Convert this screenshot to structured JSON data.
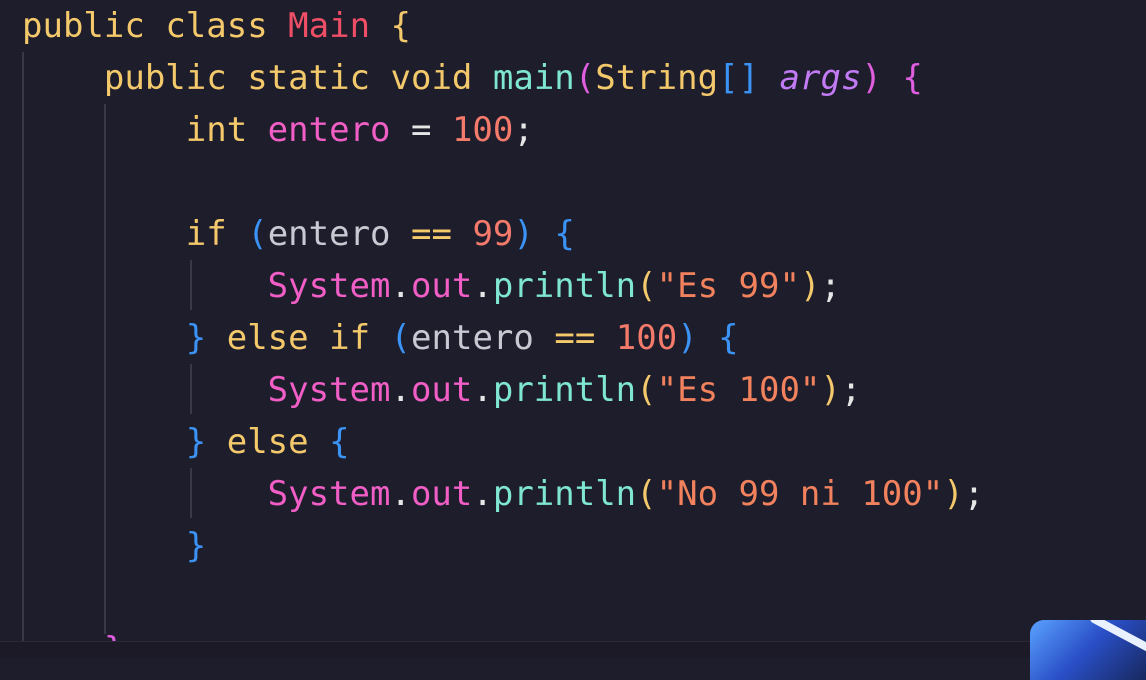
{
  "editor": {
    "lines": [
      {
        "tokens": [
          {
            "t": "public",
            "c": "kw"
          },
          {
            "t": " ",
            "c": "plain"
          },
          {
            "t": "class",
            "c": "kw"
          },
          {
            "t": " ",
            "c": "plain"
          },
          {
            "t": "Main",
            "c": "cls"
          },
          {
            "t": " ",
            "c": "plain"
          },
          {
            "t": "{",
            "c": "p1"
          }
        ]
      },
      {
        "tokens": [
          {
            "t": "    ",
            "c": "plain"
          },
          {
            "t": "public",
            "c": "kw"
          },
          {
            "t": " ",
            "c": "plain"
          },
          {
            "t": "static",
            "c": "kw"
          },
          {
            "t": " ",
            "c": "plain"
          },
          {
            "t": "void",
            "c": "kw"
          },
          {
            "t": " ",
            "c": "plain"
          },
          {
            "t": "main",
            "c": "fn"
          },
          {
            "t": "(",
            "c": "p2"
          },
          {
            "t": "String",
            "c": "kw"
          },
          {
            "t": "[]",
            "c": "p3"
          },
          {
            "t": " ",
            "c": "plain"
          },
          {
            "t": "args",
            "c": "param"
          },
          {
            "t": ")",
            "c": "p2"
          },
          {
            "t": " ",
            "c": "plain"
          },
          {
            "t": "{",
            "c": "p2"
          }
        ]
      },
      {
        "tokens": [
          {
            "t": "        ",
            "c": "plain"
          },
          {
            "t": "int",
            "c": "kw"
          },
          {
            "t": " ",
            "c": "plain"
          },
          {
            "t": "entero",
            "c": "var"
          },
          {
            "t": " ",
            "c": "plain"
          },
          {
            "t": "=",
            "c": "plain"
          },
          {
            "t": " ",
            "c": "plain"
          },
          {
            "t": "100",
            "c": "num"
          },
          {
            "t": ";",
            "c": "plain"
          }
        ]
      },
      {
        "tokens": []
      },
      {
        "tokens": [
          {
            "t": "        ",
            "c": "plain"
          },
          {
            "t": "if",
            "c": "kw"
          },
          {
            "t": " ",
            "c": "plain"
          },
          {
            "t": "(",
            "c": "p3"
          },
          {
            "t": "entero",
            "c": "dim"
          },
          {
            "t": " ",
            "c": "plain"
          },
          {
            "t": "==",
            "c": "kw"
          },
          {
            "t": " ",
            "c": "plain"
          },
          {
            "t": "99",
            "c": "num"
          },
          {
            "t": ")",
            "c": "p3"
          },
          {
            "t": " ",
            "c": "plain"
          },
          {
            "t": "{",
            "c": "p3"
          }
        ]
      },
      {
        "tokens": [
          {
            "t": "            ",
            "c": "plain"
          },
          {
            "t": "System",
            "c": "var"
          },
          {
            "t": ".",
            "c": "plain"
          },
          {
            "t": "out",
            "c": "var"
          },
          {
            "t": ".",
            "c": "plain"
          },
          {
            "t": "println",
            "c": "fn"
          },
          {
            "t": "(",
            "c": "p1"
          },
          {
            "t": "\"Es 99\"",
            "c": "str"
          },
          {
            "t": ")",
            "c": "p1"
          },
          {
            "t": ";",
            "c": "plain"
          }
        ]
      },
      {
        "tokens": [
          {
            "t": "        ",
            "c": "plain"
          },
          {
            "t": "}",
            "c": "p3"
          },
          {
            "t": " ",
            "c": "plain"
          },
          {
            "t": "else",
            "c": "kw"
          },
          {
            "t": " ",
            "c": "plain"
          },
          {
            "t": "if",
            "c": "kw"
          },
          {
            "t": " ",
            "c": "plain"
          },
          {
            "t": "(",
            "c": "p3"
          },
          {
            "t": "entero",
            "c": "dim"
          },
          {
            "t": " ",
            "c": "plain"
          },
          {
            "t": "==",
            "c": "kw"
          },
          {
            "t": " ",
            "c": "plain"
          },
          {
            "t": "100",
            "c": "num"
          },
          {
            "t": ")",
            "c": "p3"
          },
          {
            "t": " ",
            "c": "plain"
          },
          {
            "t": "{",
            "c": "p3"
          }
        ]
      },
      {
        "tokens": [
          {
            "t": "            ",
            "c": "plain"
          },
          {
            "t": "System",
            "c": "var"
          },
          {
            "t": ".",
            "c": "plain"
          },
          {
            "t": "out",
            "c": "var"
          },
          {
            "t": ".",
            "c": "plain"
          },
          {
            "t": "println",
            "c": "fn"
          },
          {
            "t": "(",
            "c": "p1"
          },
          {
            "t": "\"Es 100\"",
            "c": "str"
          },
          {
            "t": ")",
            "c": "p1"
          },
          {
            "t": ";",
            "c": "plain"
          }
        ]
      },
      {
        "tokens": [
          {
            "t": "        ",
            "c": "plain"
          },
          {
            "t": "}",
            "c": "p3"
          },
          {
            "t": " ",
            "c": "plain"
          },
          {
            "t": "else",
            "c": "kw"
          },
          {
            "t": " ",
            "c": "plain"
          },
          {
            "t": "{",
            "c": "p3"
          }
        ]
      },
      {
        "tokens": [
          {
            "t": "            ",
            "c": "plain"
          },
          {
            "t": "System",
            "c": "var"
          },
          {
            "t": ".",
            "c": "plain"
          },
          {
            "t": "out",
            "c": "var"
          },
          {
            "t": ".",
            "c": "plain"
          },
          {
            "t": "println",
            "c": "fn"
          },
          {
            "t": "(",
            "c": "p1"
          },
          {
            "t": "\"No 99 ni 100\"",
            "c": "str"
          },
          {
            "t": ")",
            "c": "p1"
          },
          {
            "t": ";",
            "c": "plain"
          }
        ]
      },
      {
        "tokens": [
          {
            "t": "        ",
            "c": "plain"
          },
          {
            "t": "}",
            "c": "p3"
          }
        ]
      },
      {
        "tokens": []
      },
      {
        "tokens": [
          {
            "t": "    ",
            "c": "plain"
          },
          {
            "t": "}",
            "c": "p2"
          }
        ]
      }
    ]
  },
  "colors": {
    "background": "#1e1d2b",
    "keyword": "#f4c96b",
    "class_name": "#ef4f66",
    "function": "#7ee6d2",
    "variable": "#f05ec6",
    "number": "#f47a6b",
    "string": "#f2825d",
    "parameter": "#c27bf5",
    "bracket_level1": "#f4c96b",
    "bracket_level2": "#e05ee0",
    "bracket_level3": "#3b93f5"
  }
}
